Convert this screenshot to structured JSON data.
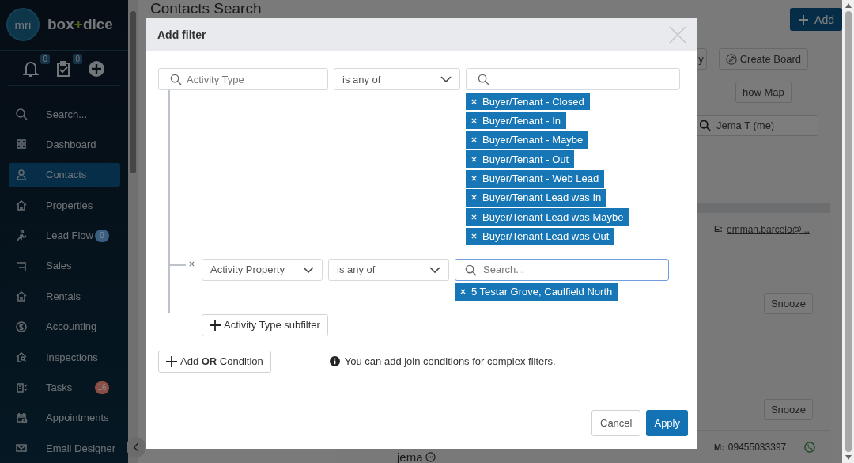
{
  "sidebar": {
    "brand": {
      "logo": "mri",
      "left": "box",
      "mark": "+",
      "right": "dice"
    },
    "notifications": [
      {
        "badge": "0"
      },
      {
        "badge": "0"
      }
    ],
    "items": [
      {
        "label": "Search...",
        "selected": false
      },
      {
        "label": "Dashboard",
        "selected": false
      },
      {
        "label": "Contacts",
        "selected": true
      },
      {
        "label": "Properties",
        "selected": false
      },
      {
        "label": "Lead Flow",
        "selected": false,
        "badge": "0",
        "color": "#3b5f80"
      },
      {
        "label": "Sales",
        "selected": false
      },
      {
        "label": "Rentals",
        "selected": false
      },
      {
        "label": "Accounting",
        "selected": false
      },
      {
        "label": "Inspections",
        "selected": false
      },
      {
        "label": "Tasks",
        "selected": false,
        "badge": "16",
        "color": "#8a4e44"
      },
      {
        "label": "Appointments",
        "selected": false
      },
      {
        "label": "Email Designer",
        "selected": false
      }
    ]
  },
  "page": {
    "title": "Contacts Search",
    "add_button": "Add",
    "toolbar": [
      {
        "label": "y",
        "kind": "text"
      },
      {
        "label": "Create Board",
        "kind": "icon-text"
      }
    ],
    "map_button": "how Map",
    "agent_filter": "Jema T (me)",
    "cards": [
      {
        "email_label": "E:",
        "email": "emman.barcelo@...",
        "snooze": "Snooze"
      },
      {
        "snooze": "Snooze"
      }
    ],
    "last_contact": {
      "name": "jema",
      "phone_label": "M:",
      "phone": "09455033397"
    }
  },
  "modal": {
    "title": "Add filter",
    "filter": {
      "field_placeholder": "Activity Type",
      "operator": "is any of",
      "focused": false,
      "tags": [
        "Buyer/Tenant - Closed",
        "Buyer/Tenant - In",
        "Buyer/Tenant - Maybe",
        "Buyer/Tenant - Out",
        "Buyer/Tenant - Web Lead",
        "Buyer/Tenant Lead was In",
        "Buyer/Tenant Lead was Maybe",
        "Buyer/Tenant Lead was Out"
      ]
    },
    "subfilters": [
      {
        "field": "Activity Property",
        "operator": "is any of",
        "search_placeholder": "Search...",
        "focused": true,
        "tags": [
          "5 Testar Grove, Caulfield North"
        ]
      }
    ],
    "subfilter_button": "Activity Type subfilter",
    "or_button": "Add **OR** Condition",
    "info": "You can add join conditions for complex filters.",
    "cancel": "Cancel",
    "apply": "Apply"
  }
}
